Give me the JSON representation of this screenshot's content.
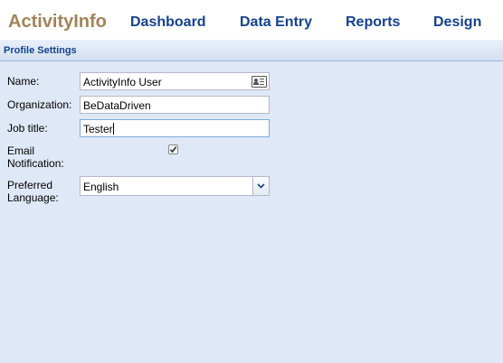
{
  "header": {
    "brand": "ActivityInfo",
    "nav": [
      "Dashboard",
      "Data Entry",
      "Reports",
      "Design"
    ]
  },
  "panel": {
    "title": "Profile Settings"
  },
  "form": {
    "name_label": "Name:",
    "name_value": "ActivityInfo User",
    "org_label": "Organization:",
    "org_value": "BeDataDriven",
    "job_label": "Job title:",
    "job_value": "Tester",
    "email_label_1": "Email",
    "email_label_2": "Notification:",
    "email_checked": true,
    "lang_label_1": "Preferred",
    "lang_label_2": "Language:",
    "lang_value": "English"
  },
  "colors": {
    "brand": "#a0845a",
    "nav": "#15428b",
    "background": "#dfe8f6"
  },
  "icons": {
    "name_field": "contact-card-icon",
    "checkbox": "checkmark-icon",
    "dropdown": "chevron-down-icon"
  }
}
